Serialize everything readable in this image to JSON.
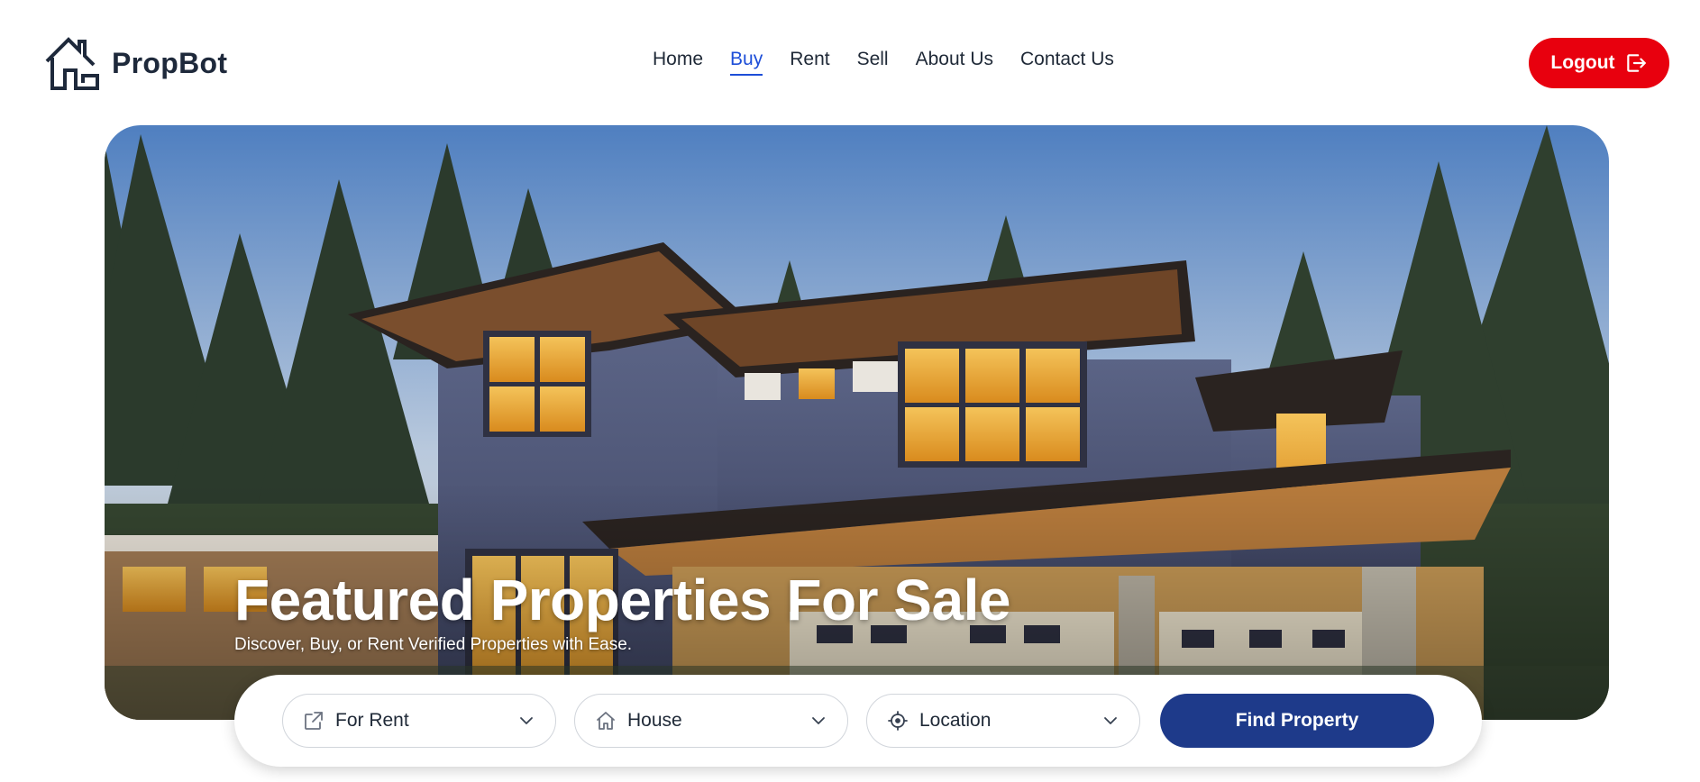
{
  "brand": {
    "name": "PropBot"
  },
  "nav": {
    "items": [
      {
        "label": "Home",
        "active": false
      },
      {
        "label": "Buy",
        "active": true
      },
      {
        "label": "Rent",
        "active": false
      },
      {
        "label": "Sell",
        "active": false
      },
      {
        "label": "About Us",
        "active": false
      },
      {
        "label": "Contact Us",
        "active": false
      }
    ]
  },
  "header": {
    "logout_label": "Logout",
    "logout_icon": "logout-icon"
  },
  "hero": {
    "title": "Featured Properties For Sale",
    "subtitle": "Discover, Buy, or Rent Verified Properties with Ease."
  },
  "search": {
    "listing_type": {
      "value": "For Rent",
      "icon": "external-link-icon"
    },
    "property_type": {
      "value": "House",
      "icon": "home-icon"
    },
    "location": {
      "value": "Location",
      "icon": "location-target-icon"
    },
    "submit_label": "Find Property"
  },
  "colors": {
    "accent_red": "#e8000e",
    "accent_blue": "#1d4ed8",
    "button_navy": "#1e3a8a",
    "text_dark": "#1e293b"
  }
}
